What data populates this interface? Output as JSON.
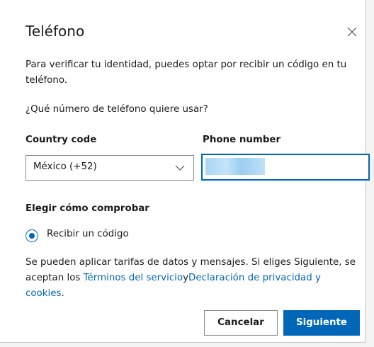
{
  "dialog": {
    "title": "Teléfono",
    "intro": "Para verificar tu identidad, puedes optar por recibir un código en tu teléfono.",
    "question": "¿Qué número de teléfono quiere usar?",
    "country_code_label": "Country code",
    "country_code_value": "México (+52)",
    "phone_number_label": "Phone number",
    "method_label": "Elegir cómo comprobar",
    "method_option": "Recibir un código",
    "legal_text": "Se pueden aplicar tarifas de datos y mensajes. Si eliges Siguiente, se aceptan los ",
    "terms_link": "Términos del servicio",
    "and_text": "y",
    "privacy_link": "Declaración de privacidad y cookies",
    "period": ".",
    "cancel_label": "Cancelar",
    "next_label": "Siguiente"
  },
  "icons": {
    "close": "close-icon",
    "chevron": "chevron-down-icon"
  },
  "colors": {
    "accent": "#0067b8",
    "text": "#1b1b1b"
  }
}
